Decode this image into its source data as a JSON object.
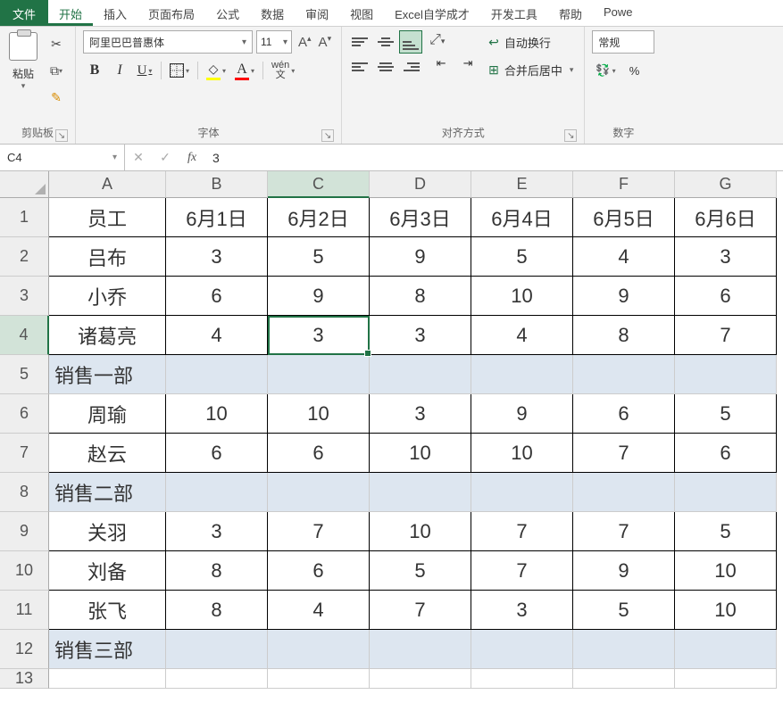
{
  "menu": {
    "file": "文件",
    "home": "开始",
    "insert": "插入",
    "pagelayout": "页面布局",
    "formulas": "公式",
    "data": "数据",
    "review": "审阅",
    "view": "视图",
    "excelself": "Excel自学成才",
    "devtools": "开发工具",
    "help": "帮助",
    "power": "Powe"
  },
  "ribbon": {
    "clipboard": {
      "label": "剪贴板",
      "paste": "粘贴"
    },
    "font": {
      "label": "字体",
      "name": "阿里巴巴普惠体",
      "size": "11",
      "wen": "wén",
      "wenchar": "文"
    },
    "alignment": {
      "label": "对齐方式"
    },
    "wrap": "自动换行",
    "merge": "合并后居中",
    "number": {
      "label": "数字",
      "format": "常规"
    }
  },
  "namebox": "C4",
  "formula_value": "3",
  "columns": [
    "A",
    "B",
    "C",
    "D",
    "E",
    "F",
    "G"
  ],
  "rows": [
    "1",
    "2",
    "3",
    "4",
    "5",
    "6",
    "7",
    "8",
    "9",
    "10",
    "11",
    "12",
    "13"
  ],
  "selected": {
    "row": 4,
    "col": "C"
  },
  "chart_data": {
    "type": "table",
    "headers": [
      "员工",
      "6月1日",
      "6月2日",
      "6月3日",
      "6月4日",
      "6月5日",
      "6月6日"
    ],
    "rows": [
      {
        "type": "data",
        "cells": [
          "吕布",
          "3",
          "5",
          "9",
          "5",
          "4",
          "3"
        ]
      },
      {
        "type": "data",
        "cells": [
          "小乔",
          "6",
          "9",
          "8",
          "10",
          "9",
          "6"
        ]
      },
      {
        "type": "data",
        "cells": [
          "诸葛亮",
          "4",
          "3",
          "3",
          "4",
          "8",
          "7"
        ]
      },
      {
        "type": "section",
        "label": "销售一部"
      },
      {
        "type": "data",
        "cells": [
          "周瑜",
          "10",
          "10",
          "3",
          "9",
          "6",
          "5"
        ]
      },
      {
        "type": "data",
        "cells": [
          "赵云",
          "6",
          "6",
          "10",
          "10",
          "7",
          "6"
        ]
      },
      {
        "type": "section",
        "label": "销售二部"
      },
      {
        "type": "data",
        "cells": [
          "关羽",
          "3",
          "7",
          "10",
          "7",
          "7",
          "5"
        ]
      },
      {
        "type": "data",
        "cells": [
          "刘备",
          "8",
          "6",
          "5",
          "7",
          "9",
          "10"
        ]
      },
      {
        "type": "data",
        "cells": [
          "张飞",
          "8",
          "4",
          "7",
          "3",
          "5",
          "10"
        ]
      },
      {
        "type": "section",
        "label": "销售三部"
      }
    ]
  }
}
